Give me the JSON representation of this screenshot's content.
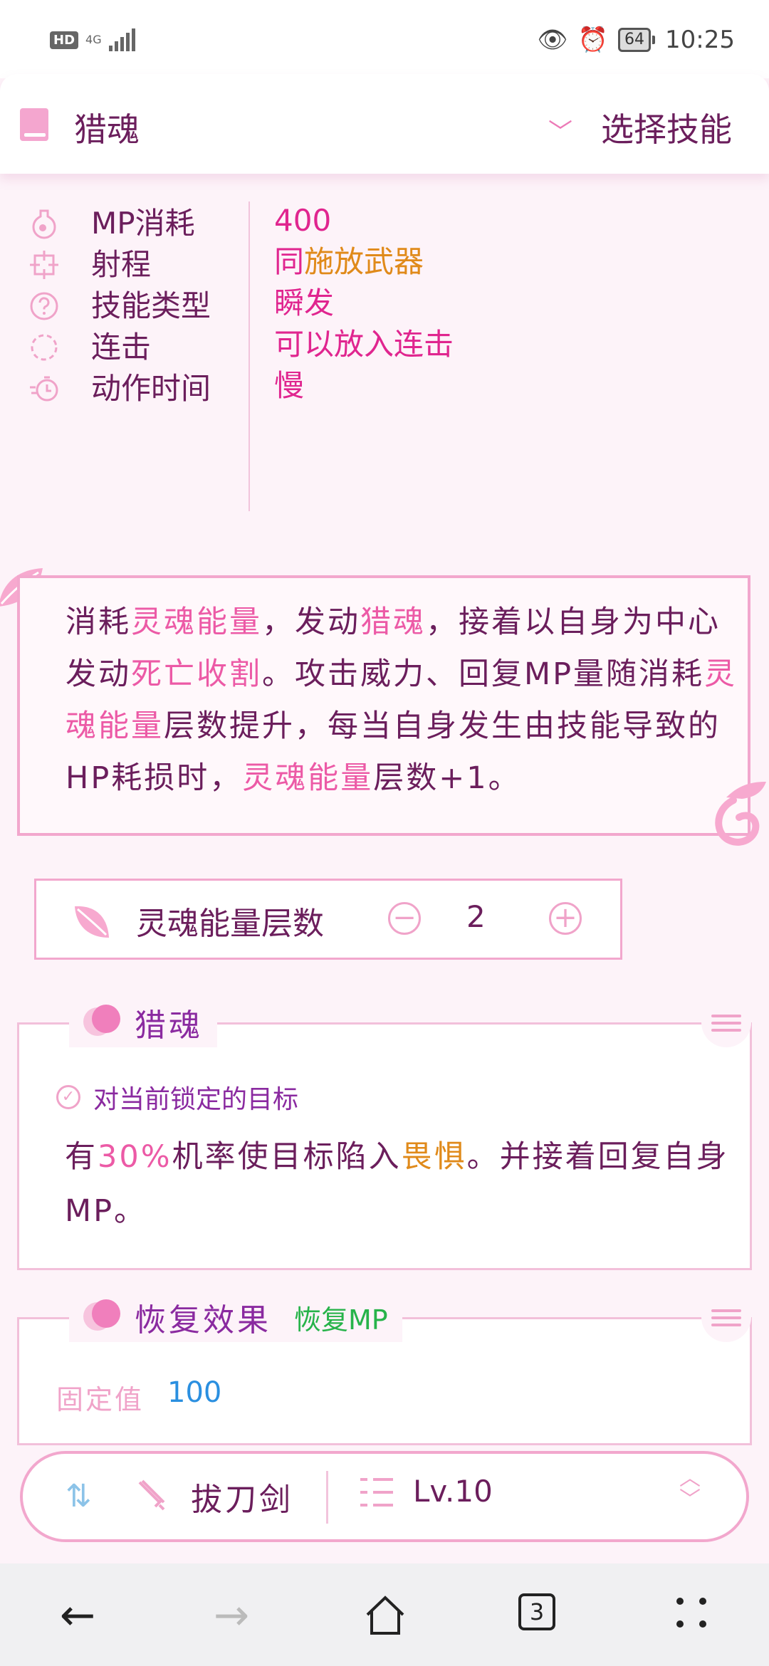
{
  "status_bar": {
    "hd": "HD",
    "network": "4G",
    "battery": "64",
    "time": "10:25"
  },
  "header": {
    "skill_name": "猎魂",
    "select_label": "选择技能"
  },
  "props": [
    {
      "label": "MP消耗",
      "value": "400",
      "icon": "potion-icon"
    },
    {
      "label": "射程",
      "value_a": "同",
      "value_b": "施放武器",
      "icon": "crosshair-icon"
    },
    {
      "label": "技能类型",
      "value": "瞬发",
      "icon": "question-icon"
    },
    {
      "label": "连击",
      "value": "可以放入连击",
      "icon": "combo-icon"
    },
    {
      "label": "动作时间",
      "value": "慢",
      "icon": "timer-icon"
    }
  ],
  "description": {
    "p1": "消耗",
    "h1": "灵魂能量",
    "p2": "，发动",
    "h2": "猎魂",
    "p3": "，接着以自身为中心发动",
    "h3": "死亡收割",
    "p4": "。攻击威力、回复MP量随消耗",
    "h4": "灵魂能量",
    "p5": "层数提升，每当自身发生由技能导致的HP耗损时，",
    "h5": "灵魂能量",
    "p6": "层数+1。"
  },
  "stacks": {
    "label": "灵魂能量层数",
    "minus": "−",
    "plus": "+",
    "value": "2"
  },
  "panel_hunt": {
    "title": "猎魂",
    "target": "对当前锁定的目标",
    "t1": "有",
    "t2": "30%",
    "t3": "机率使目标陷入",
    "t4": "畏惧",
    "t5": "。并接着回复自身MP。"
  },
  "panel_recover": {
    "title": "恢复效果",
    "subtitle": "恢复MP",
    "fixed_label": "固定值",
    "fixed_value": "100"
  },
  "bottom_bar": {
    "weapon": "拔刀剑",
    "level": "Lv.10"
  },
  "nav": {
    "tab_count": "3"
  },
  "colors": {
    "accent_pink": "#ec5aa6",
    "text_dark": "#6b1e5c",
    "orange": "#e08a1a",
    "green": "#27b34a",
    "blue": "#2a8fe0"
  }
}
